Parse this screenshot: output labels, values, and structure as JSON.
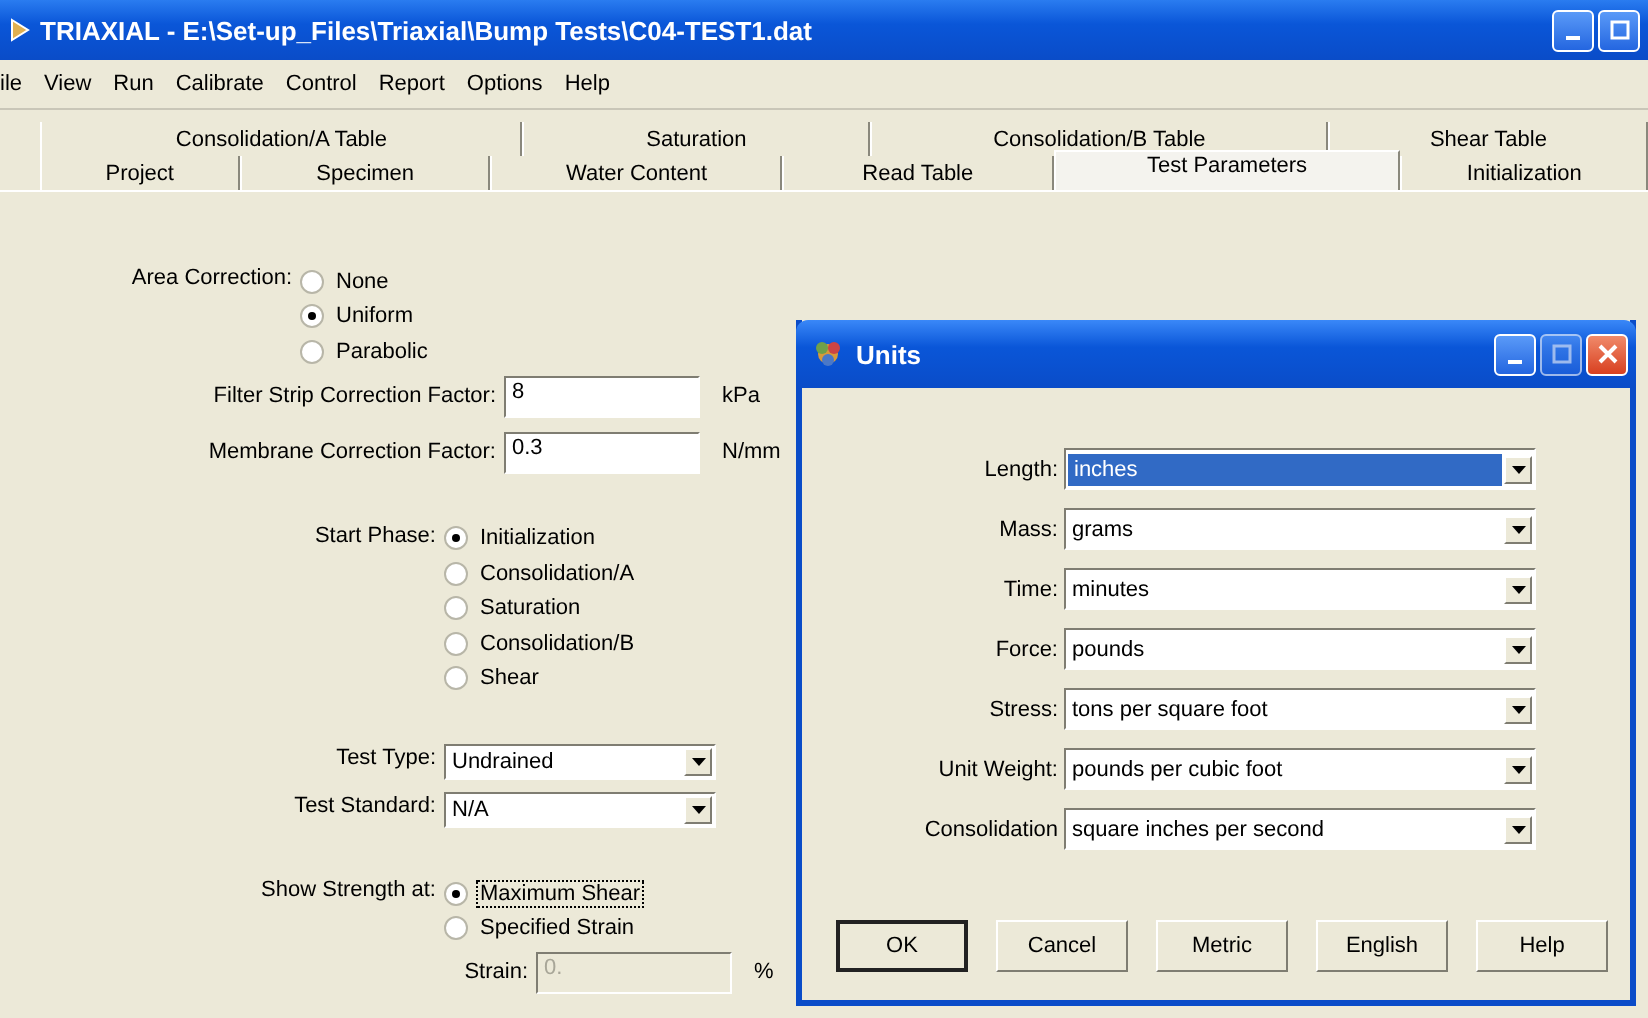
{
  "window": {
    "title": "TRIAXIAL - E:\\Set-up_Files\\Triaxial\\Bump Tests\\C04-TEST1.dat"
  },
  "menu": [
    "ile",
    "View",
    "Run",
    "Calibrate",
    "Control",
    "Report",
    "Options",
    "Help"
  ],
  "tab_rows": [
    [
      {
        "label": "Consolidation/A Table",
        "selected": false
      },
      {
        "label": "Saturation",
        "selected": false
      },
      {
        "label": "Consolidation/B Table",
        "selected": false
      },
      {
        "label": "Shear Table",
        "selected": false
      }
    ],
    [
      {
        "label": "Project",
        "selected": false
      },
      {
        "label": "Specimen",
        "selected": false
      },
      {
        "label": "Water Content",
        "selected": false
      },
      {
        "label": "Read Table",
        "selected": false
      },
      {
        "label": "Test Parameters",
        "selected": true
      },
      {
        "label": "Initialization",
        "selected": false
      }
    ]
  ],
  "form": [
    {
      "kind": "radio",
      "label": "Area Correction:",
      "options": [
        {
          "label": "None",
          "selected": false,
          "focused": false
        },
        {
          "label": "Uniform",
          "selected": true,
          "focused": false
        },
        {
          "label": "Parabolic",
          "selected": false,
          "focused": false
        }
      ]
    },
    {
      "kind": "text",
      "label": "Filter Strip Correction Factor:",
      "value": "8",
      "unit": "kPa",
      "disabled": false
    },
    {
      "kind": "text",
      "label": "Membrane Correction Factor:",
      "value": "0.3",
      "unit": "N/mm",
      "disabled": false
    },
    {
      "kind": "radio",
      "label": "Start Phase:",
      "options": [
        {
          "label": "Initialization",
          "selected": true,
          "focused": false
        },
        {
          "label": "Consolidation/A",
          "selected": false,
          "focused": false
        },
        {
          "label": "Saturation",
          "selected": false,
          "focused": false
        },
        {
          "label": "Consolidation/B",
          "selected": false,
          "focused": false
        },
        {
          "label": "Shear",
          "selected": false,
          "focused": false
        }
      ]
    },
    {
      "kind": "select",
      "label": "Test Type:",
      "value": "Undrained"
    },
    {
      "kind": "select",
      "label": "Test Standard:",
      "value": "N/A"
    },
    {
      "kind": "radio",
      "label": "Show Strength at:",
      "options": [
        {
          "label": "Maximum Shear",
          "selected": true,
          "focused": true
        },
        {
          "label": "Specified Strain",
          "selected": false,
          "focused": false
        }
      ]
    },
    {
      "kind": "text",
      "label": "Strain:",
      "value": "0.",
      "unit": "%",
      "disabled": true
    }
  ],
  "units_dialog": {
    "title": "Units",
    "fields": [
      {
        "label": "Length:",
        "value": "inches",
        "highlighted": true
      },
      {
        "label": "Mass:",
        "value": "grams",
        "highlighted": false
      },
      {
        "label": "Time:",
        "value": "minutes",
        "highlighted": false
      },
      {
        "label": "Force:",
        "value": "pounds",
        "highlighted": false
      },
      {
        "label": "Stress:",
        "value": "tons per square foot",
        "highlighted": false
      },
      {
        "label": "Unit Weight:",
        "value": "pounds per cubic foot",
        "highlighted": false
      },
      {
        "label": "Consolidation",
        "value": "square inches per second",
        "highlighted": false
      }
    ],
    "buttons": [
      {
        "label": "OK",
        "default": true
      },
      {
        "label": "Cancel",
        "default": false
      },
      {
        "label": "Metric",
        "default": false
      },
      {
        "label": "English",
        "default": false
      },
      {
        "label": "Help",
        "default": false
      }
    ]
  }
}
